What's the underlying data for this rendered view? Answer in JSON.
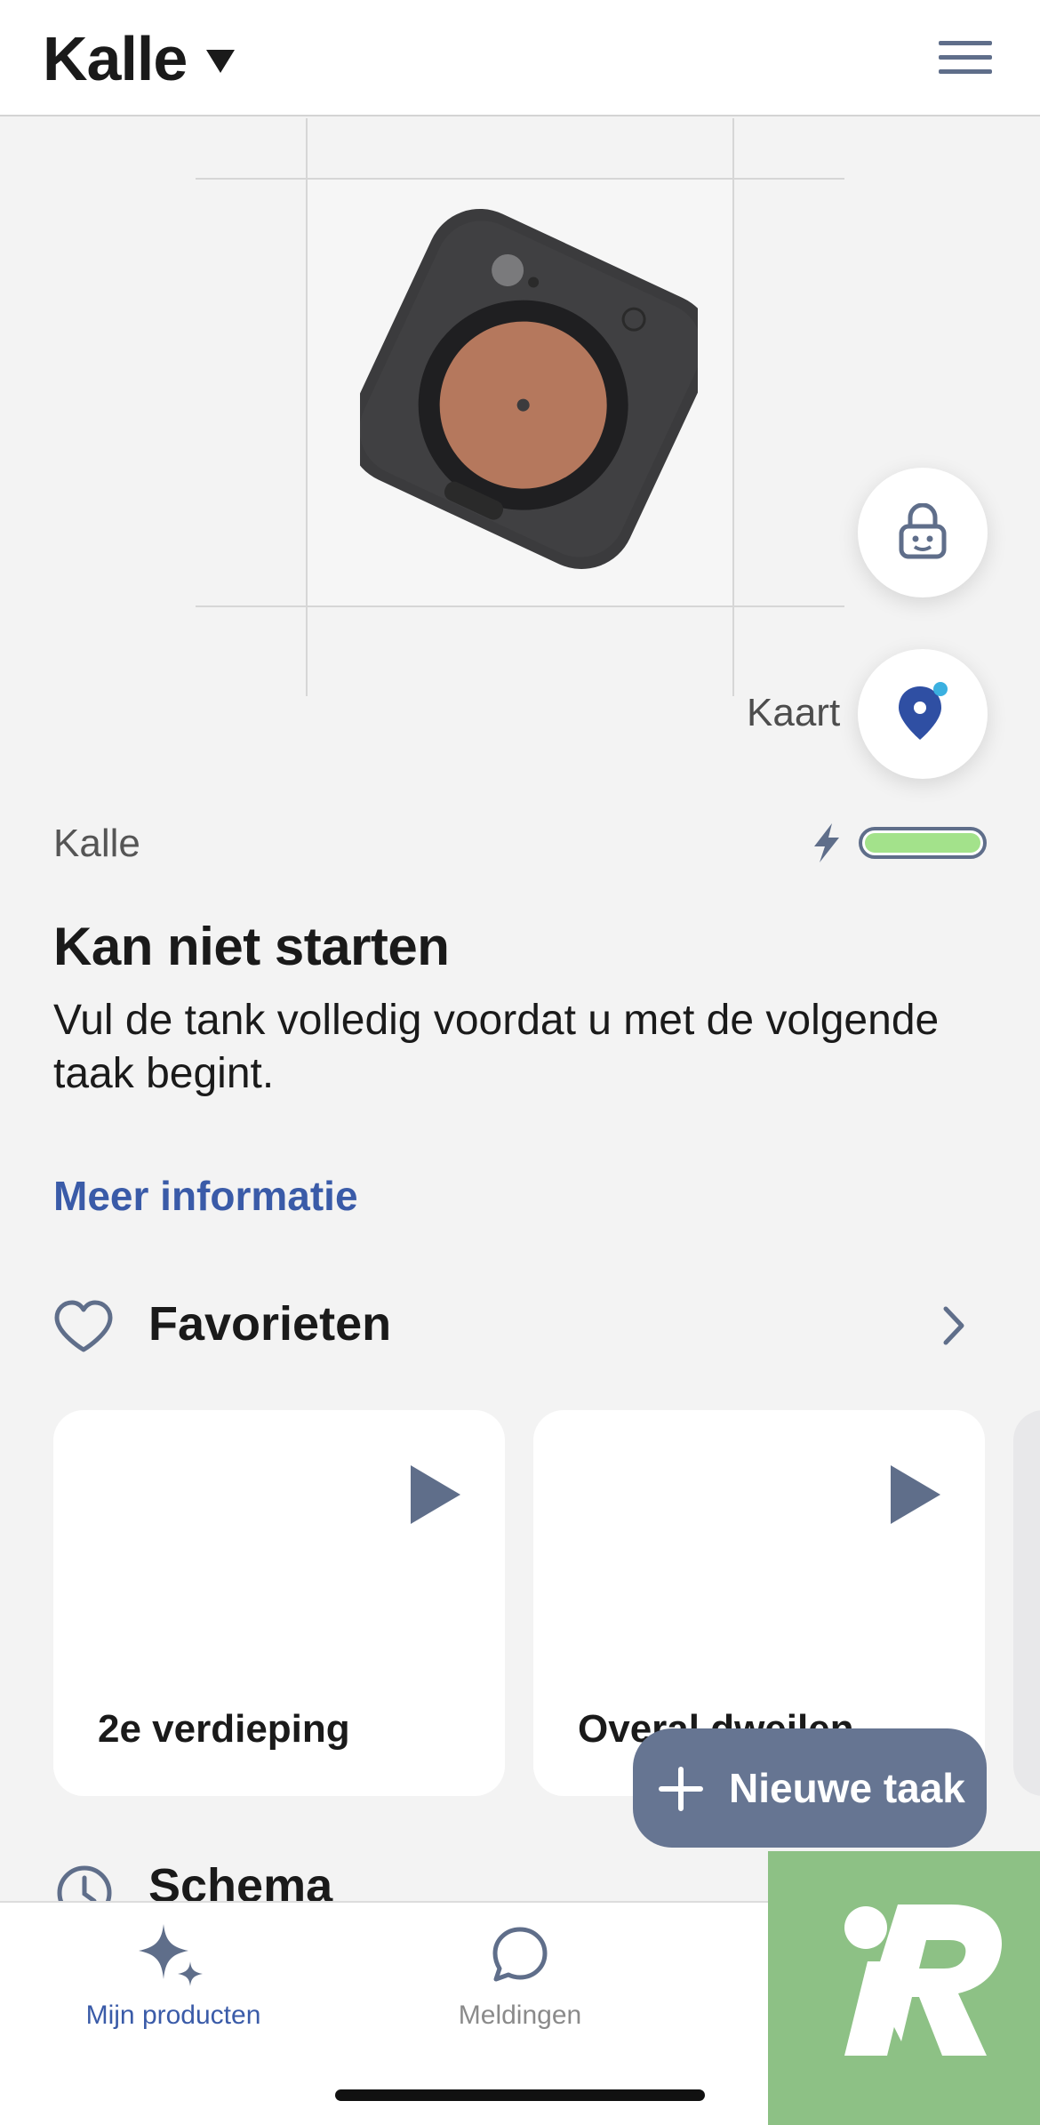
{
  "header": {
    "title": "Kalle",
    "menu_icon": "hamburger-menu-icon"
  },
  "robot": {
    "image_icon": "robot-mop-top-view",
    "lock_icon": "child-lock-icon",
    "map_label": "Kaart",
    "map_icon": "map-pin-icon"
  },
  "status": {
    "robot_name": "Kalle",
    "battery_level": 1.0,
    "charging": true,
    "title": "Kan niet starten",
    "description": "Vul de tank volledig voordat u met de volgende taak begint.",
    "more_link": "Meer informatie"
  },
  "favorites": {
    "title": "Favorieten",
    "items": [
      {
        "label": "2e verdieping"
      },
      {
        "label": "Overal dweilen"
      }
    ]
  },
  "new_task": {
    "label": "Nieuwe taak"
  },
  "schedule": {
    "title": "Schema"
  },
  "tabbar": {
    "tabs": [
      {
        "label": "Mijn producten",
        "icon": "sparkle-icon",
        "active": true
      },
      {
        "label": "Meldingen",
        "icon": "chat-bubble-icon",
        "active": false
      }
    ]
  },
  "colors": {
    "accent": "#3a5ba8",
    "button": "#667592",
    "battery": "#a3e28b",
    "badge": "#8dc185",
    "pad": "#b5785d"
  }
}
